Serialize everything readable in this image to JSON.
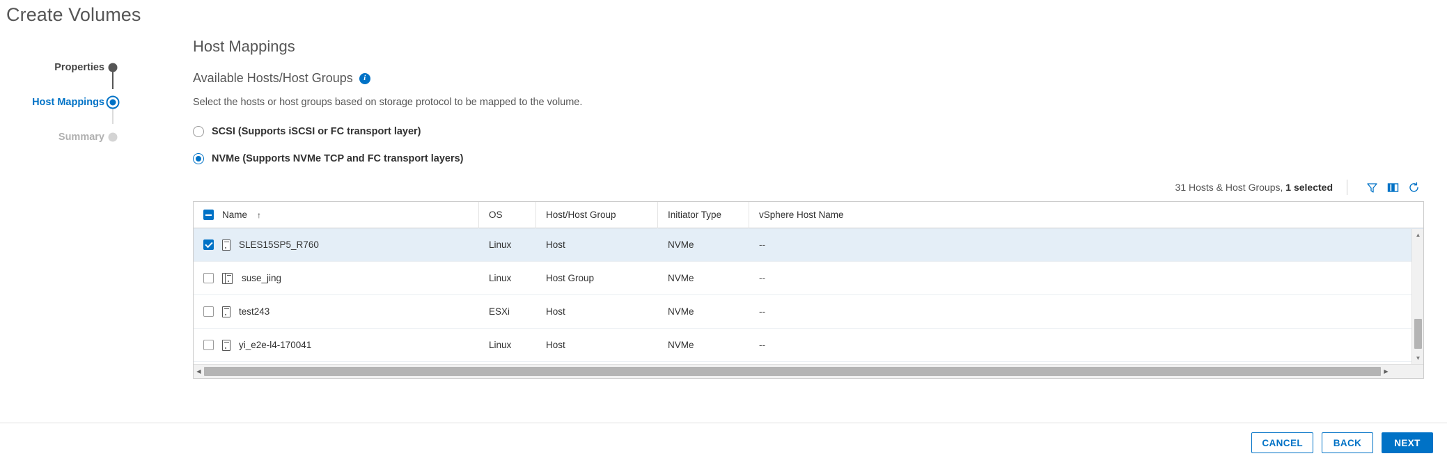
{
  "wizard": {
    "title": "Create Volumes",
    "steps": [
      {
        "label": "Properties",
        "state": "done"
      },
      {
        "label": "Host Mappings",
        "state": "current"
      },
      {
        "label": "Summary",
        "state": "todo"
      }
    ]
  },
  "panel": {
    "title": "Host Mappings",
    "section_heading": "Available Hosts/Host Groups",
    "description": "Select the hosts or host groups based on storage protocol to be mapped to the volume."
  },
  "protocol": {
    "options": [
      {
        "label": "SCSI (Supports iSCSI or FC transport layer)",
        "selected": false
      },
      {
        "label": "NVMe (Supports NVMe TCP and FC transport layers)",
        "selected": true
      }
    ]
  },
  "toolbar": {
    "count_prefix": "31 Hosts & Host Groups, ",
    "count_selected": "1 selected",
    "filter_title": "Filter",
    "columns_title": "Show/Hide Columns",
    "refresh_title": "Refresh"
  },
  "table": {
    "sort_indicator": "↑",
    "columns": [
      "Name",
      "OS",
      "Host/Host Group",
      "Initiator Type",
      "vSphere Host Name"
    ],
    "rows": [
      {
        "name": "SLES15SP5_R760",
        "os": "Linux",
        "host_group": "Host",
        "initiator_type": "NVMe",
        "vsphere_host_name": "--",
        "icon": "host-icon",
        "checked": true
      },
      {
        "name": "suse_jing",
        "os": "Linux",
        "host_group": "Host Group",
        "initiator_type": "NVMe",
        "vsphere_host_name": "--",
        "icon": "host-group-icon",
        "checked": false
      },
      {
        "name": "test243",
        "os": "ESXi",
        "host_group": "Host",
        "initiator_type": "NVMe",
        "vsphere_host_name": "--",
        "icon": "host-icon",
        "checked": false
      },
      {
        "name": "yi_e2e-l4-170041",
        "os": "Linux",
        "host_group": "Host",
        "initiator_type": "NVMe",
        "vsphere_host_name": "--",
        "icon": "host-icon",
        "checked": false
      }
    ]
  },
  "footer": {
    "cancel": "CANCEL",
    "back": "BACK",
    "next": "NEXT"
  },
  "colors": {
    "accent": "#0072c6",
    "selected_row": "#e4eef7",
    "text": "#313131",
    "muted": "#565656"
  }
}
